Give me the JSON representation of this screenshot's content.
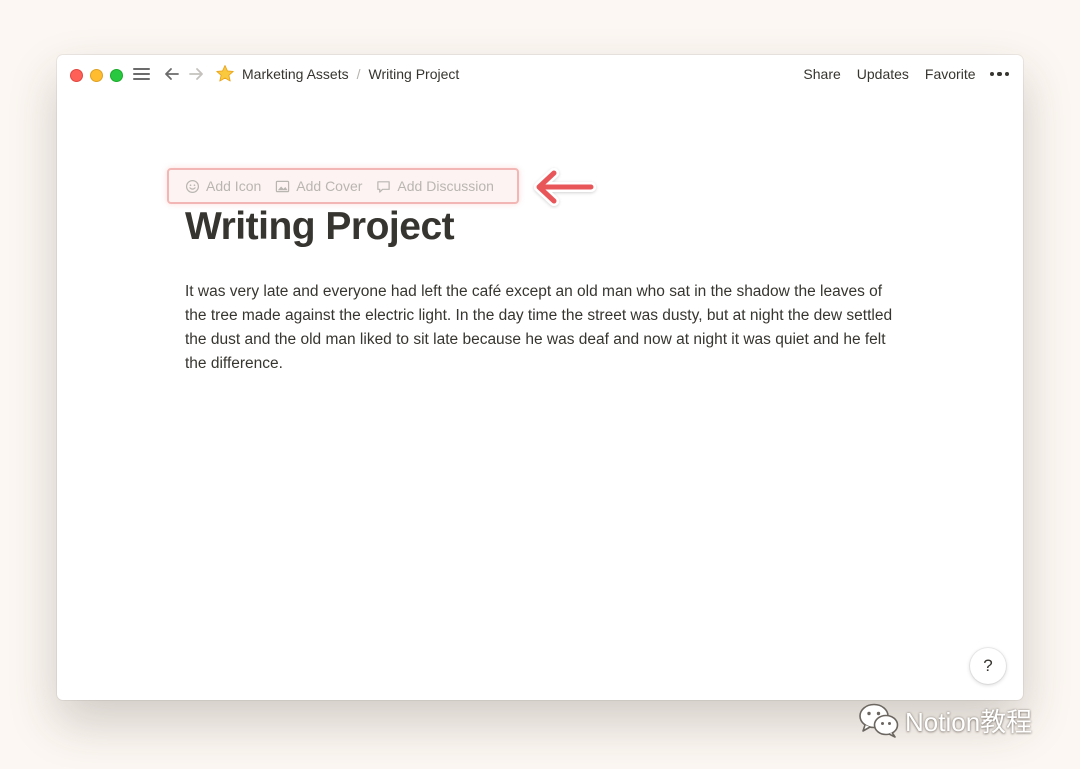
{
  "window": {
    "breadcrumb": {
      "icon": "star-icon",
      "items": [
        "Marketing Assets",
        "Writing Project"
      ],
      "separator": "/"
    },
    "actions": {
      "share": "Share",
      "updates": "Updates",
      "favorite": "Favorite",
      "more_icon": "more-icon"
    }
  },
  "page": {
    "controls": {
      "add_icon": "Add Icon",
      "add_cover": "Add Cover",
      "add_discussion": "Add Discussion"
    },
    "title": "Writing Project",
    "body": "It was very late and everyone had left the café except an old man who sat in the shadow the leaves of the tree made against the electric light. In the day time the street was dusty, but at night the dew settled the dust and the old man liked to sit late because he was deaf and now at night it was quiet and he felt the difference."
  },
  "help": {
    "label": "?"
  },
  "watermark": {
    "text": "Notion教程",
    "icon": "wechat-icon"
  },
  "colors": {
    "background": "#fcf7f2",
    "highlight_border": "#f2b7b4",
    "arrow": "#e8575a",
    "text": "#37352f",
    "muted_text": "#b9b6b1"
  }
}
